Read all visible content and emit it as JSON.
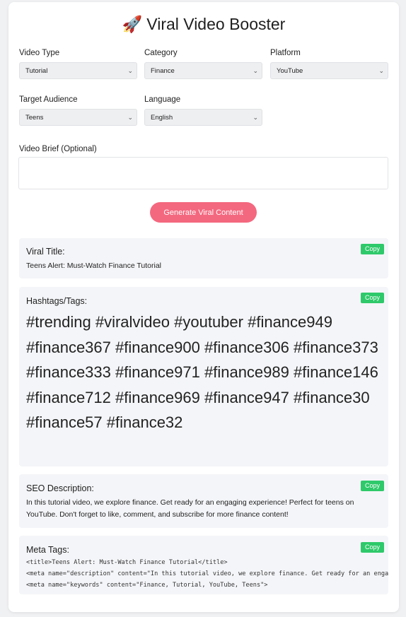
{
  "header": {
    "icon": "rocket-icon",
    "icon_glyph": "🚀",
    "title": "Viral Video Booster"
  },
  "form": {
    "video_type": {
      "label": "Video Type",
      "value": "Tutorial"
    },
    "category": {
      "label": "Category",
      "value": "Finance"
    },
    "platform": {
      "label": "Platform",
      "value": "YouTube"
    },
    "target_audience": {
      "label": "Target Audience",
      "value": "Teens"
    },
    "language": {
      "label": "Language",
      "value": "English"
    },
    "brief": {
      "label": "Video Brief (Optional)",
      "value": ""
    },
    "generate_label": "Generate Viral Content"
  },
  "results": {
    "copy_label": "Copy",
    "title": {
      "heading": "Viral Title:",
      "text": "Teens Alert: Must-Watch Finance Tutorial"
    },
    "hashtags": {
      "heading": "Hashtags/Tags:",
      "text": "#trending #viralvideo #youtuber #finance949 #finance367 #finance900 #finance306 #finance373 #finance333 #finance971 #finance989 #finance146 #finance712 #finance969 #finance947 #finance30 #finance57 #finance32"
    },
    "seo": {
      "heading": "SEO Description:",
      "text": "In this tutorial video, we explore finance. Get ready for an engaging experience! Perfect for teens on YouTube. Don't forget to like, comment, and subscribe for more finance content!"
    },
    "meta": {
      "heading": "Meta Tags:",
      "lines": [
        "<title>Teens Alert: Must-Watch Finance Tutorial</title>",
        "<meta name=\"description\" content=\"In this tutorial video, we explore finance. Get ready for an engag",
        "<meta name=\"keywords\" content=\"Finance, Tutorial, YouTube, Teens\">"
      ]
    }
  },
  "colors": {
    "accent": "#f4687f",
    "copy_button": "#2ec96a",
    "panel_bg": "#f4f5f8"
  }
}
